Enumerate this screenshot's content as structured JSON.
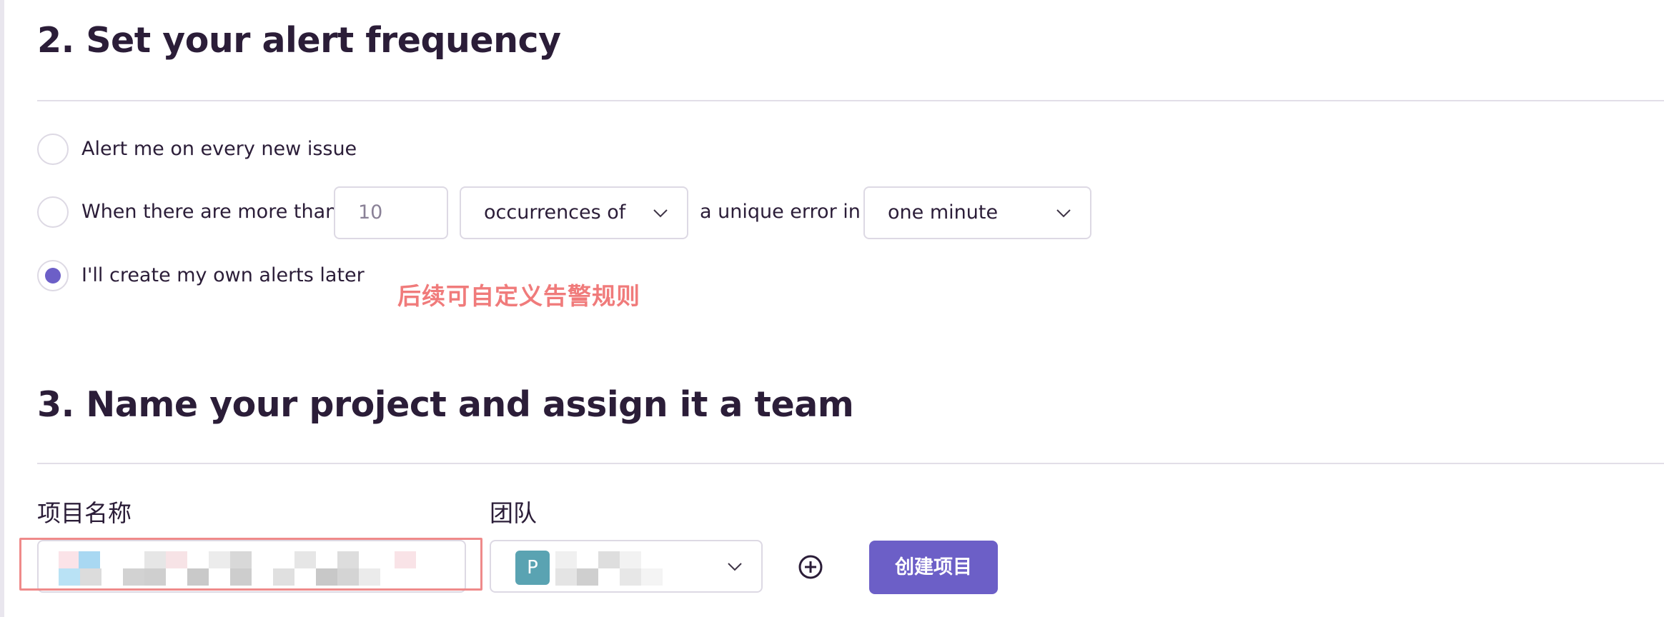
{
  "section2": {
    "title": "2. Set your alert frequency",
    "options": [
      {
        "label": "Alert me on every new issue",
        "checked": false
      },
      {
        "label": "When there are more than",
        "checked": false
      },
      {
        "label": "I'll create my own alerts later",
        "checked": true
      }
    ],
    "threshold_placeholder": "10",
    "metric_select": "occurrences of",
    "connector_text": "a unique error in",
    "interval_select": "one minute",
    "annotation": "后续可自定义告警规则"
  },
  "section3": {
    "title": "3. Name your project and assign it a team",
    "project_name_label": "项目名称",
    "team_label": "团队",
    "team_avatar_letter": "P",
    "create_button": "创建项目"
  },
  "colors": {
    "accent": "#6c5fc7",
    "annotation": "#f07b7b",
    "border": "#ddd9e4"
  },
  "icons": [
    "chevron-down-icon",
    "add-circle-icon"
  ]
}
